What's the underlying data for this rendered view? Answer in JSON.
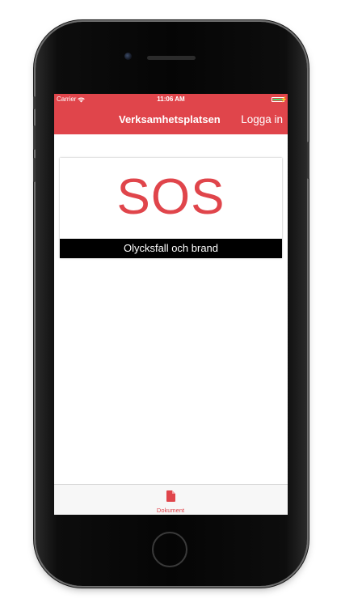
{
  "status_bar": {
    "carrier": "Carrier",
    "time": "11:06 AM"
  },
  "nav_bar": {
    "title": "Verksamhetsplatsen",
    "login_label": "Logga in"
  },
  "card": {
    "title": "SOS",
    "caption": "Olycksfall och brand"
  },
  "tab_bar": {
    "items": [
      {
        "label": "Dokument",
        "icon": "document-icon"
      }
    ]
  },
  "colors": {
    "accent": "#e0454b",
    "caption_bg": "#000000"
  }
}
